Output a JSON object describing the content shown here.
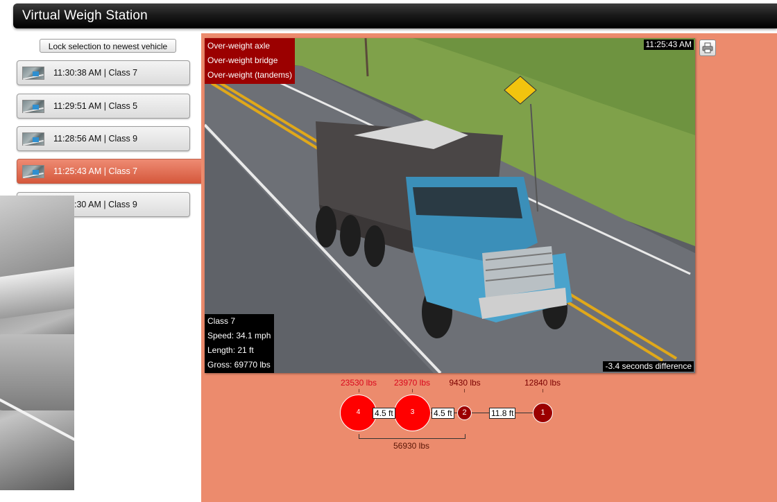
{
  "app": {
    "title": "Virtual Weigh Station"
  },
  "left_panel": {
    "lock_button_label": "Lock selection to newest vehicle",
    "vehicles": [
      {
        "label": "11:30:38 AM | Class 7",
        "selected": false
      },
      {
        "label": "11:29:51 AM | Class 5",
        "selected": false
      },
      {
        "label": "11:28:56 AM | Class 9",
        "selected": false
      },
      {
        "label": "11:25:43 AM | Class 7",
        "selected": true
      },
      {
        "label": ":30 AM | Class 9",
        "selected": false
      }
    ]
  },
  "camera": {
    "alerts": [
      "Over-weight axle",
      "Over-weight bridge",
      "Over-weight (tandems)"
    ],
    "timestamp": "11:25:43 AM",
    "info": {
      "class": "Class 7",
      "speed": "Speed: 34.1 mph",
      "length": "Length: 21 ft",
      "gross": "Gross: 69770 lbs"
    },
    "difference": "-3.4 seconds difference"
  },
  "toolbar": {
    "print_icon": "printer-icon"
  },
  "axle_diagram": {
    "axles": [
      {
        "number": "4",
        "weight": "23530 lbs",
        "overweight": true
      },
      {
        "number": "3",
        "weight": "23970 lbs",
        "overweight": true
      },
      {
        "number": "2",
        "weight": "9430 lbs",
        "overweight": false
      },
      {
        "number": "1",
        "weight": "12840 lbs",
        "overweight": false
      }
    ],
    "spacings": [
      "4.5 ft",
      "4.5 ft",
      "11.8 ft"
    ],
    "group_total": "56930 lbs"
  },
  "colors": {
    "panel_bg": "#ec8b6d",
    "alert_bg": "#9b0000",
    "overweight_axle": "#ff0000",
    "normal_axle": "#9b0000"
  }
}
